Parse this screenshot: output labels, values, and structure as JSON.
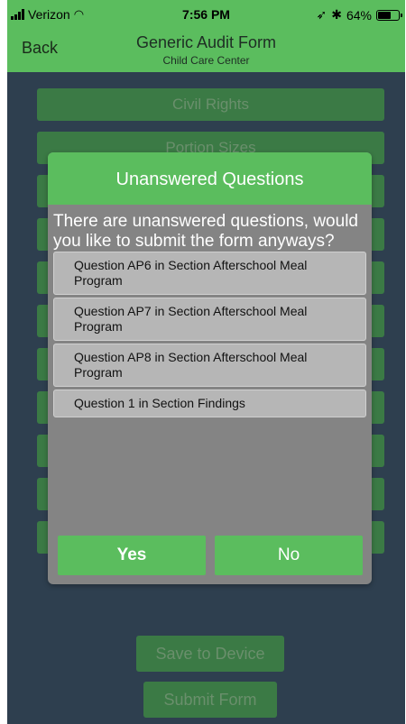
{
  "status_bar": {
    "carrier": "Verizon",
    "time": "7:56 PM",
    "battery": "64%",
    "battery_level": 0.64,
    "icons": [
      "signal-icon",
      "wifi-icon",
      "location-icon",
      "bluetooth-icon",
      "battery-icon"
    ]
  },
  "nav": {
    "back_label": "Back",
    "title": "Generic Audit Form",
    "subtitle": "Child Care Center"
  },
  "sections": [
    "Civil Rights",
    "Portion Sizes",
    "",
    "",
    "",
    "",
    "",
    "",
    "",
    "",
    "",
    ""
  ],
  "bottom": {
    "save_label": "Save to Device",
    "submit_label": "Submit Form"
  },
  "modal": {
    "title": "Unanswered Questions",
    "message": "There are unanswered questions, would you like to submit the form anyways?",
    "questions": [
      "Question AP6 in Section Afterschool Meal Program",
      "Question AP7 in Section Afterschool Meal Program",
      "Question AP8 in Section Afterschool Meal Program",
      "Question 1 in Section Findings"
    ],
    "yes_label": "Yes",
    "no_label": "No"
  },
  "colors": {
    "accent_green": "#5bbd5e",
    "background": "#2e3f4f",
    "modal_body": "#848484",
    "dimmed_button": "#3b7a45"
  }
}
